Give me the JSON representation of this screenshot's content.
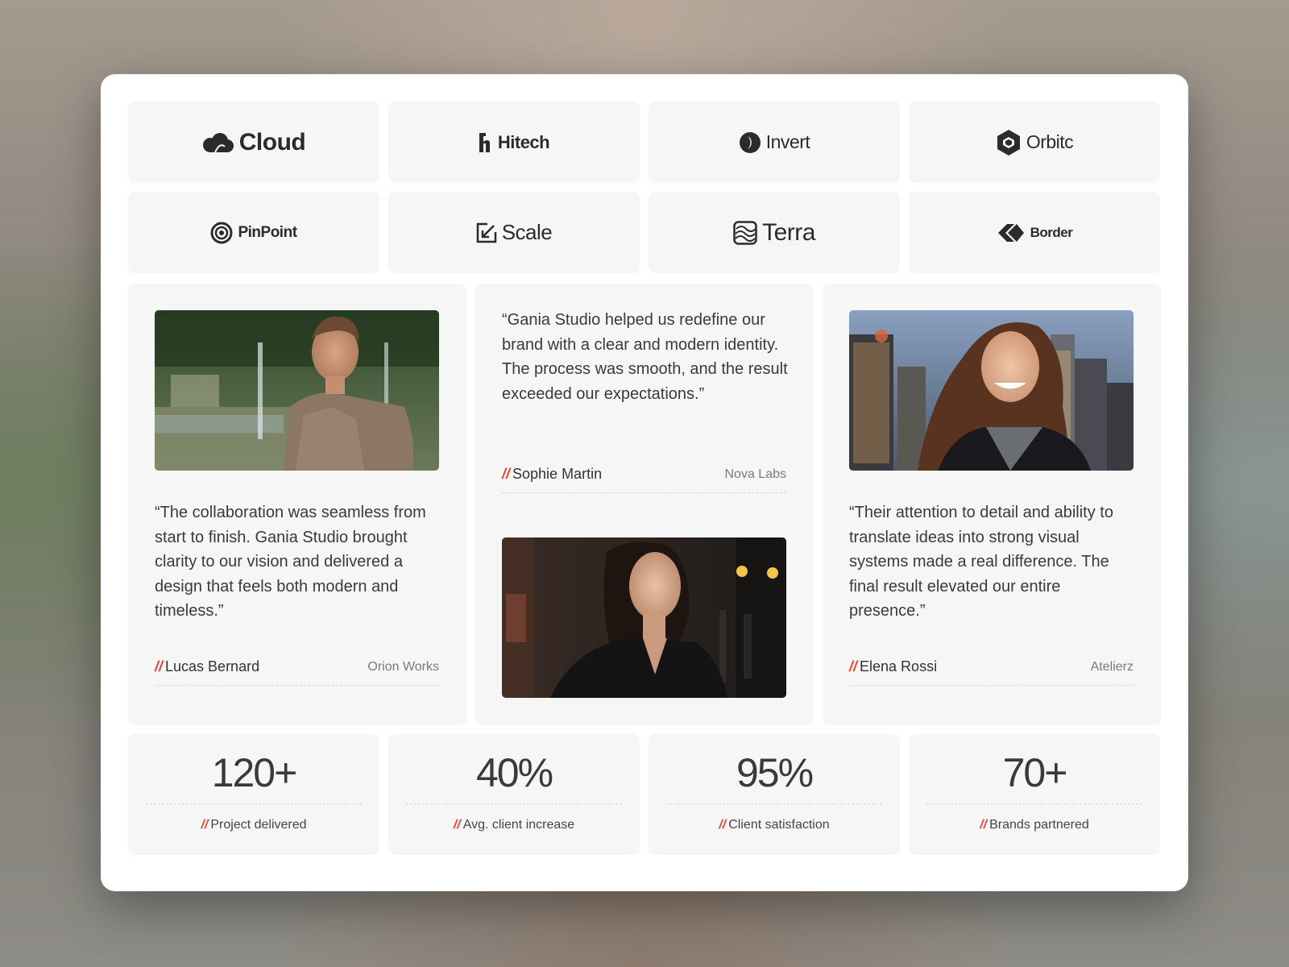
{
  "logos": [
    {
      "name": "Cloud",
      "icon": "cloud-icon"
    },
    {
      "name": "Hitech",
      "icon": "hitech-h-icon"
    },
    {
      "name": "Invert",
      "icon": "invert-moon-icon"
    },
    {
      "name": "Orbitc",
      "icon": "orbitc-hexagon-icon"
    },
    {
      "name": "PinPoint",
      "icon": "pinpoint-target-icon"
    },
    {
      "name": "Scale",
      "icon": "scale-arrow-icon"
    },
    {
      "name": "Terra",
      "icon": "terra-wave-icon"
    },
    {
      "name": "Border",
      "icon": "border-diamond-icon"
    }
  ],
  "testimonials": [
    {
      "quote": "“The collaboration was seamless from start to finish. Gania Studio brought clarity to our vision and delivered a design that feels both modern and timeless.”",
      "name": "Lucas Bernard",
      "company": "Orion Works",
      "photo": "man-in-garden-photo"
    },
    {
      "quote": "“Gania Studio helped us redefine our brand with a clear and modern identity. The process was smooth, and the result exceeded our expectations.”",
      "name": "Sophie Martin",
      "company": "Nova Labs",
      "photo": "woman-street-night-photo"
    },
    {
      "quote": "“Their attention to detail and ability to translate ideas into strong visual systems made a real difference. The final result elevated our entire presence.”",
      "name": "Elena Rossi",
      "company": "Atelierz",
      "photo": "woman-city-smiling-photo"
    }
  ],
  "slash": "//",
  "stats": [
    {
      "value": "120+",
      "label": "Project delivered"
    },
    {
      "value": "40%",
      "label": "Avg. client increase"
    },
    {
      "value": "95%",
      "label": "Client satisfaction"
    },
    {
      "value": "70+",
      "label": "Brands partnered"
    }
  ],
  "colors": {
    "accent": "#e5443a",
    "card_bg": "#f6f6f6",
    "text": "#3a3a3a"
  }
}
